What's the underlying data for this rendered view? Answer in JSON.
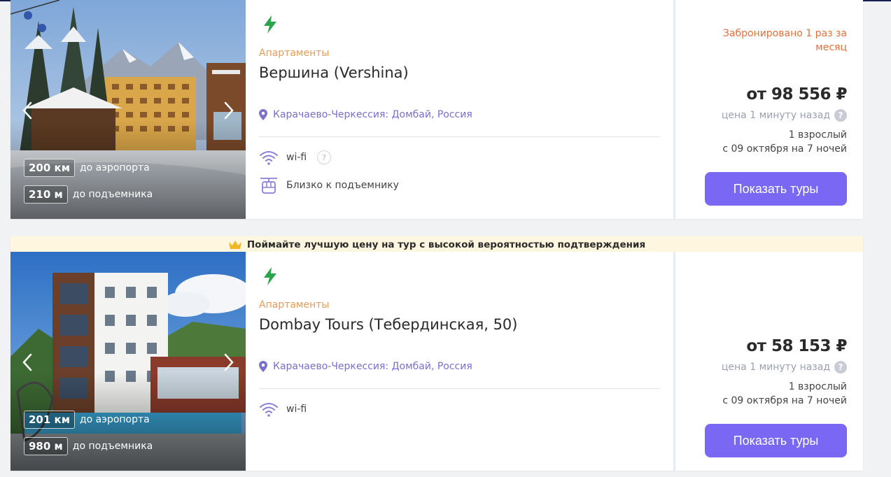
{
  "banner_text": "Поймайте лучшую цену на тур с высокой вероятностью подтверждения",
  "colors": {
    "accent": "#7a68f5",
    "booked": "#e2703d",
    "type": "#e69c55",
    "location": "#7a6fc9",
    "bolt": "#2aa44a"
  },
  "hotels": [
    {
      "type": "Апартаменты",
      "name": "Вершина (Vershina)",
      "location": "Карачаево-Черкессия: Домбай, Россия",
      "distances": [
        {
          "value": "200 км",
          "label": "до аэропорта"
        },
        {
          "value": "210 м",
          "label": "до подъемника"
        }
      ],
      "features": [
        {
          "icon": "wifi-icon",
          "label": "wi-fi",
          "help": "?"
        },
        {
          "icon": "cable-car-icon",
          "label": "Близко к подъемнику"
        }
      ],
      "booked": "Забронировано 1 раз за месяц",
      "price": "от 98 556 ₽",
      "price_updated": "цена 1 минуту назад",
      "help": "?",
      "guests": "1 взрослый",
      "dates": "с 09 октября на 7 ночей",
      "button": "Показать туры"
    },
    {
      "type": "Апартаменты",
      "name": "Dombay Tours (Тебердинская, 50)",
      "location": "Карачаево-Черкессия: Домбай, Россия",
      "distances": [
        {
          "value": "201 км",
          "label": "до аэропорта"
        },
        {
          "value": "980 м",
          "label": "до подъемника"
        }
      ],
      "features": [
        {
          "icon": "wifi-icon",
          "label": "wi-fi"
        }
      ],
      "price": "от 58 153 ₽",
      "price_updated": "цена 1 минуту назад",
      "help": "?",
      "guests": "1 взрослый",
      "dates": "с 09 октября на 7 ночей",
      "button": "Показать туры"
    }
  ]
}
